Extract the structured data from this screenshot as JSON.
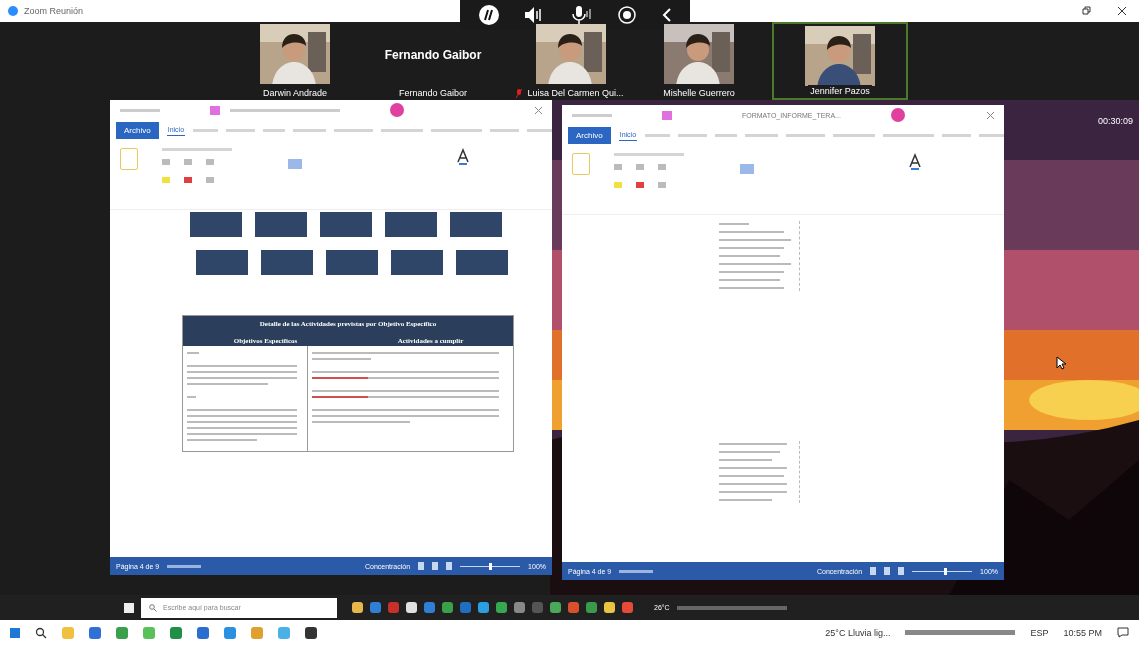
{
  "window": {
    "title": "Zoom Reunión"
  },
  "participants": [
    {
      "kind": "video",
      "name": "Darwin Andrade",
      "muted": false,
      "active": false
    },
    {
      "kind": "name_only",
      "big_name": "Fernando Gaibor",
      "name": "Fernando Gaibor",
      "muted": false,
      "active": false
    },
    {
      "kind": "video",
      "name": "Luisa Del Carmen Qui...",
      "muted": true,
      "active": false
    },
    {
      "kind": "video",
      "name": "Mishelle Guerrero",
      "muted": false,
      "active": false
    },
    {
      "kind": "video",
      "name": "Jennifer Pazos",
      "muted": false,
      "active": true
    }
  ],
  "timer": "00:30:09",
  "documents": [
    {
      "file_tab": "Archivo",
      "tab": "Inicio",
      "content": {
        "kind": "flowchart_table",
        "table_title": "Detalle de las Actividades previstas por Objetivo Específico",
        "columns": [
          "Objetivos Específicos",
          "Actividades a cumplir"
        ]
      },
      "status": {
        "page": "Página 4 de 9",
        "focus": "Concentración",
        "zoom": "100%",
        "level": 0.5
      }
    },
    {
      "title": "FORMATO_INFORME_TERA...",
      "file_tab": "Archivo",
      "tab": "Inicio",
      "content": {
        "kind": "column_text"
      },
      "status": {
        "page": "Página 4 de 9",
        "focus": "Concentración",
        "zoom": "100%",
        "level": 0.55
      }
    }
  ],
  "remote_taskbar": {
    "search_placeholder": "Escribe aquí para buscar",
    "weather": "26°C"
  },
  "taskbar": {
    "weather": "25°C  Lluvia lig...",
    "language": "ESP",
    "time": "10:55 PM"
  }
}
